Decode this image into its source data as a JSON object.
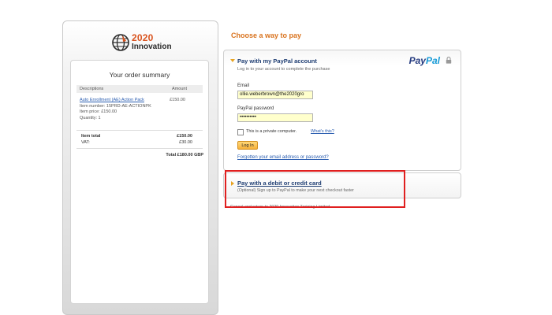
{
  "brand": {
    "line1": "2020",
    "line2": "Innovation"
  },
  "order_summary": {
    "title": "Your order summary",
    "col_descriptions": "Descriptions",
    "col_amount": "Amount",
    "item": {
      "name": "Auto Enrollment (AE) Action Pack",
      "number": "Item number: 15PRD-AE-ACTIONPK",
      "price": "Item price: £150.00",
      "quantity": "Quantity: 1",
      "amount": "£150.00"
    },
    "item_total_label": "Item total",
    "item_total_value": "£150.00",
    "vat_label": "VAT:",
    "vat_value": "£30.00",
    "total": "Total £180.00 GBP"
  },
  "choose_heading": "Choose a way to pay",
  "paypal": {
    "heading": "Pay with my PayPal account",
    "subtitle": "Log in to your account to complete the purchase",
    "logo_a": "Pay",
    "logo_b": "Pal",
    "email_label": "Email",
    "email_value": "ollie.weberbrown@the2020gro",
    "password_label": "PayPal password",
    "password_value": "••••••••••",
    "private_label": "This is a private computer.",
    "whats_this": "What's this?",
    "login_button": "Log In",
    "forgot_link": "Forgotten your email address or password?"
  },
  "card": {
    "heading": "Pay with a debit or credit card",
    "subtitle": "(Optional) Sign up to PayPal to make your next checkout faster"
  },
  "cancel_text": "Cancel and return to 2020 Innovation Training Limited",
  "colors": {
    "accent": "#d9731e",
    "link": "#2a5db0",
    "highlight": "#e02020",
    "field_bg": "#ffffcc"
  }
}
